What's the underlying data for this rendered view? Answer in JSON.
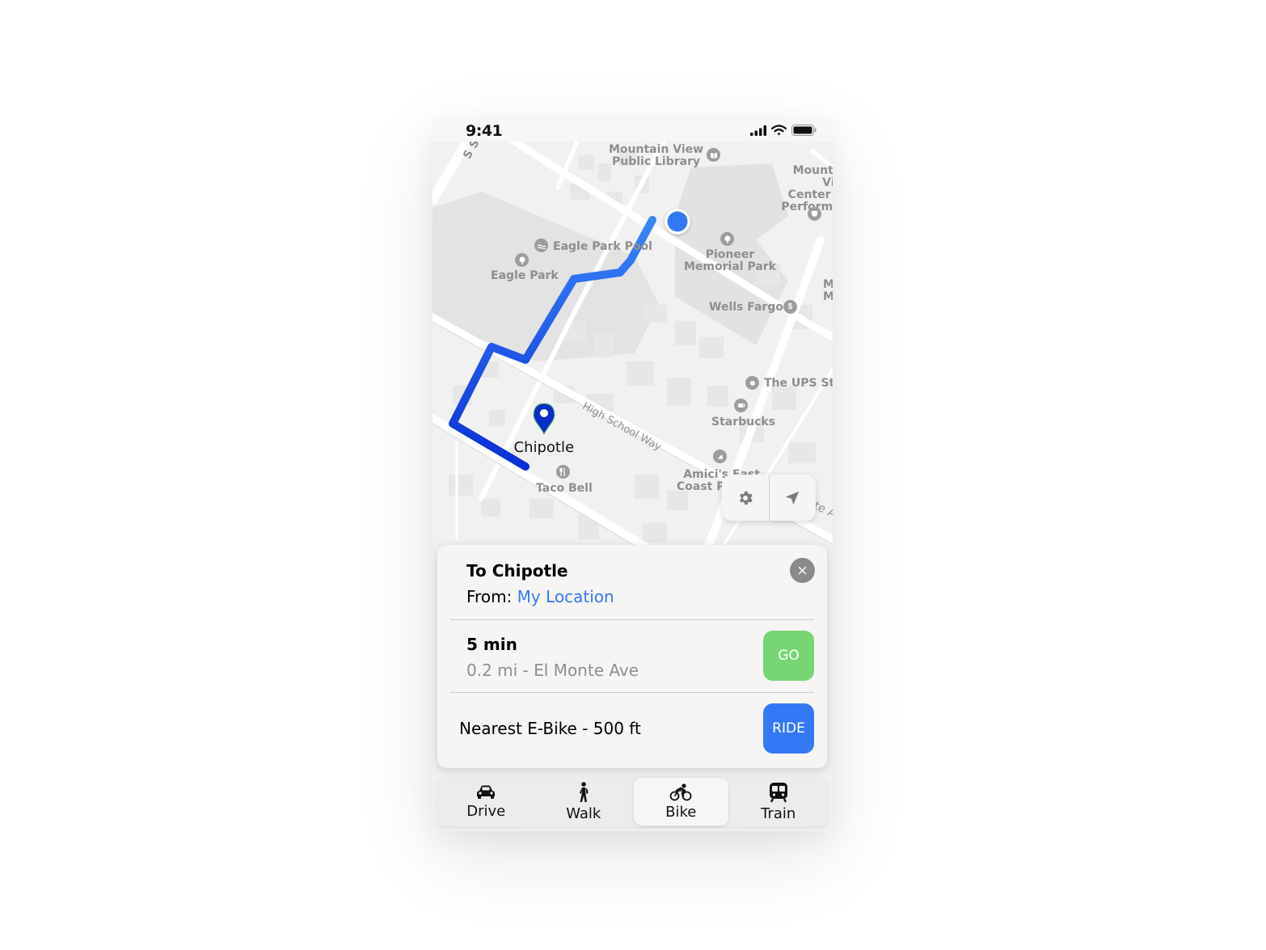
{
  "status_bar": {
    "time": "9:41"
  },
  "map": {
    "labels": {
      "shoreline": "S Shoreline",
      "library": "Mountain View\nPublic Library",
      "center": "Mountain View\nCenter for\nPerforming",
      "eagle_park_pool": "Eagle Park Pool",
      "eagle_park": "Eagle Park",
      "pioneer": "Pioneer\nMemorial Park",
      "wells_fargo": "Wells Fargo",
      "ups": "The UPS Store",
      "starbucks": "Starbucks",
      "high_school_way": "High School Way",
      "amicis": "Amici's East\nCoast Pizzeria",
      "taco_bell": "Taco Bell",
      "m_label": "M\nM",
      "ite_a": "ite A"
    },
    "destination_label": "Chipotle",
    "route_colors": {
      "start": "#3a86f7",
      "end": "#0a2fd8"
    },
    "user_dot_color": "#3478f6"
  },
  "map_controls": {
    "settings_icon": "gear-icon",
    "locate_icon": "location-arrow-icon"
  },
  "directions_card": {
    "title": "To Chipotle",
    "from_prefix": "From:",
    "from_value": "My Location",
    "close_label": "×",
    "eta": "5 min",
    "route_detail": "0.2 mi - El Monte Ave",
    "go_label": "GO",
    "ebike_text": "Nearest E-Bike - 500 ft",
    "ride_label": "RIDE"
  },
  "tabs": [
    {
      "label": "Drive",
      "icon": "car-icon",
      "active": false
    },
    {
      "label": "Walk",
      "icon": "walk-icon",
      "active": false
    },
    {
      "label": "Bike",
      "icon": "bike-icon",
      "active": true
    },
    {
      "label": "Train",
      "icon": "train-icon",
      "active": false
    }
  ],
  "colors": {
    "accent": "#3478f6",
    "go": "#77d574",
    "link": "#3478f6"
  }
}
